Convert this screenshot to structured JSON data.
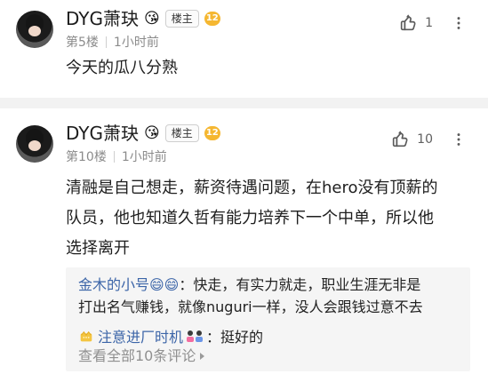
{
  "posts": [
    {
      "username": "DYG萧玦",
      "emoji": "😘",
      "host_badge": "楼主",
      "level": "12",
      "floor": "第5楼",
      "time": "1小时前",
      "likes": "1",
      "content": "今天的瓜八分熟"
    },
    {
      "username": "DYG萧玦",
      "emoji": "😘",
      "host_badge": "楼主",
      "level": "12",
      "floor": "第10楼",
      "time": "1小时前",
      "likes": "10",
      "content_lines": [
        "清融是自己想走，薪资待遇问题，在hero没有顶薪的",
        "队员，他也知道久哲有能力培养下一个中单，所以他",
        "选择离开"
      ],
      "replies": [
        {
          "name": "金木的小号😄😄",
          "separator": "：",
          "text_lines": [
            "快走，有实力就走，职业生涯无非是",
            "打出名气赚钱，就像nuguri一样，没人会跟钱过意不去"
          ]
        },
        {
          "name": "注意进厂时机",
          "separator": "：",
          "text": "挺好的"
        }
      ],
      "more_replies": "查看全部10条评论"
    }
  ]
}
